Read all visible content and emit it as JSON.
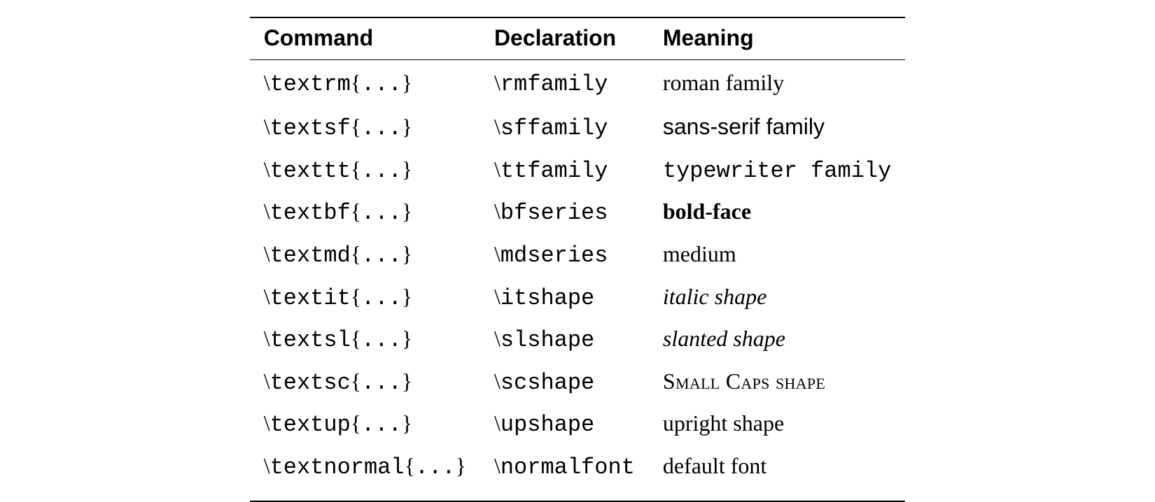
{
  "table": {
    "headers": {
      "command": "Command",
      "declaration": "Declaration",
      "meaning": "Meaning"
    },
    "rows": [
      {
        "argcmd": "textrm",
        "decl": "rmfamily",
        "meaning": "roman family",
        "meaningClass": "serif"
      },
      {
        "argcmd": "textsf",
        "decl": "sffamily",
        "meaning": "sans-serif family",
        "meaningClass": "sf"
      },
      {
        "argcmd": "texttt",
        "decl": "ttfamily",
        "meaning": "typewriter family",
        "meaningClass": "tt"
      },
      {
        "argcmd": "textbf",
        "decl": "bfseries",
        "meaning": "bold-face",
        "meaningClass": "serif bf"
      },
      {
        "argcmd": "textmd",
        "decl": "mdseries",
        "meaning": "medium",
        "meaningClass": "serif"
      },
      {
        "argcmd": "textit",
        "decl": "itshape",
        "meaning": "italic shape",
        "meaningClass": "serif it"
      },
      {
        "argcmd": "textsl",
        "decl": "slshape",
        "meaning": "slanted shape",
        "meaningClass": "serif sl"
      },
      {
        "argcmd": "textsc",
        "decl": "scshape",
        "meaning": "Small Caps shape",
        "meaningClass": "serif sc"
      },
      {
        "argcmd": "textup",
        "decl": "upshape",
        "meaning": "upright shape",
        "meaningClass": "serif"
      },
      {
        "argcmd": "textnormal",
        "decl": "normalfont",
        "meaning": "default font",
        "meaningClass": "serif"
      }
    ]
  }
}
